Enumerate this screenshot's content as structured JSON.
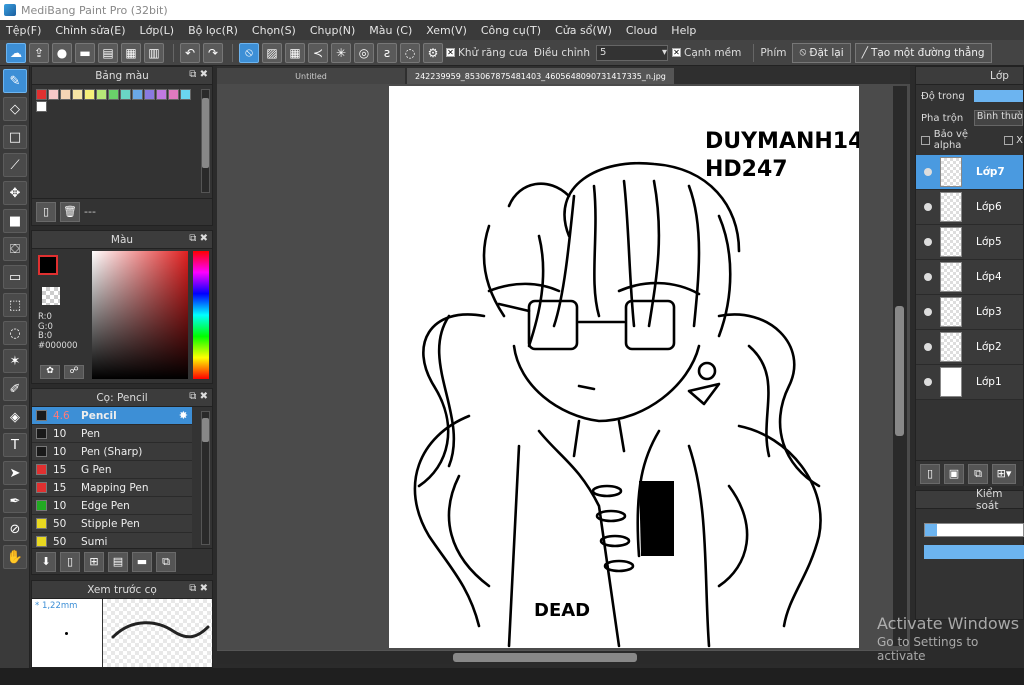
{
  "window": {
    "title": "MediBang Paint Pro (32bit)"
  },
  "menu": [
    "Tệp(F)",
    "Chỉnh sửa(E)",
    "Lớp(L)",
    "Bộ lọc(R)",
    "Chọn(S)",
    "Chụp(N)",
    "Màu (C)",
    "Xem(V)",
    "Công cụ(T)",
    "Cửa sổ(W)",
    "Cloud",
    "Help"
  ],
  "toolbar": {
    "antialias_label": "Khử răng cưa",
    "correction_label": "Điều chỉnh",
    "correction_value": "5",
    "snap_label": "Cạnh mềm",
    "key_label": "Phím",
    "reset_label": "Đặt lại",
    "new_line_label": "Tạo một đường thẳng"
  },
  "palette_panel": {
    "title": "Bảng màu",
    "footer": "---"
  },
  "palette_colors": [
    "#e03030",
    "#ffffff",
    "#f7c8c8",
    "#f5d5b5",
    "#f5e5a5",
    "#f5f07a",
    "#b6e878",
    "#6ad06a",
    "#6ad6c6",
    "#6aa8e8",
    "#8a7ae0",
    "#c07ae0",
    "#e07ac0",
    "#6ad6f0"
  ],
  "color_panel": {
    "title": "Màu",
    "r": "R:0",
    "g": "G:0",
    "b": "B:0",
    "hex": "#000000",
    "primary": "#000000",
    "secondary": "#ffffff"
  },
  "brush_panel": {
    "title": "Cọ: Pencil",
    "brushes": [
      {
        "size": "4.6",
        "name": "Pencil",
        "color": "#1a1a1a"
      },
      {
        "size": "10",
        "name": "Pen",
        "color": "#1a1a1a"
      },
      {
        "size": "10",
        "name": "Pen (Sharp)",
        "color": "#1a1a1a"
      },
      {
        "size": "15",
        "name": "G Pen",
        "color": "#e03030"
      },
      {
        "size": "15",
        "name": "Mapping Pen",
        "color": "#e03030"
      },
      {
        "size": "10",
        "name": "Edge Pen",
        "color": "#22aa22"
      },
      {
        "size": "50",
        "name": "Stipple Pen",
        "color": "#e8d820"
      },
      {
        "size": "50",
        "name": "Sumi",
        "color": "#e8d820"
      }
    ]
  },
  "preview_panel": {
    "title": "Xem trước cọ",
    "size": "* 1,22mm"
  },
  "doc_tabs": [
    "Untitled",
    "242239959_853067875481403_4605648090731417335_n.jpg"
  ],
  "layer_panel": {
    "title": "Lớp",
    "opacity_label": "Độ trong",
    "blend_label": "Pha trộn",
    "blend_value": "Bình thường",
    "protect_alpha": "Bảo vệ alpha",
    "clip_label": "X",
    "layers": [
      "Lớp7",
      "Lớp6",
      "Lớp5",
      "Lớp4",
      "Lớp3",
      "Lớp2",
      "Lớp1"
    ],
    "active_layer": "Lớp7"
  },
  "nav_panel": {
    "title": "Kiểm soát"
  },
  "drawing": {
    "text1": "DUYMANH14",
    "text2": "HD247",
    "text3": "DEAD"
  },
  "watermark": {
    "line1": "Activate Windows",
    "line2": "Go to Settings to activate"
  }
}
